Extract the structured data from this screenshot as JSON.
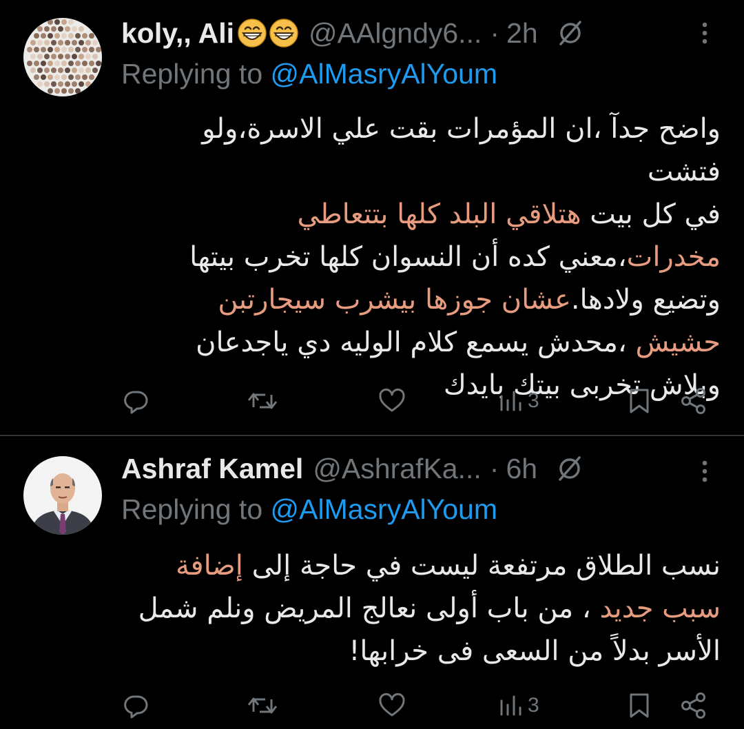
{
  "tweets": [
    {
      "display_name": "koly,, Ali",
      "emoji_icons": [
        "grinning-face-icon",
        "grinning-face-icon"
      ],
      "handle": "@AAlgndy6...",
      "separator": "·",
      "time": "2h",
      "replying_prefix": "Replying to ",
      "replying_to": "@AlMasryAlYoum",
      "body_lines": [
        {
          "a": "واضح جدآ ،ان المؤمرات بقت علي الاسرة،ولو فتشت"
        },
        {
          "a": "في كل بيت ",
          "hl": "هتلاقي البلد كلها بتتعاطي"
        },
        {
          "hl": "مخدرات",
          "b": "،معني كده أن النسوان كلها تخرب بيتها"
        },
        {
          "a": "وتضيع ولادها.",
          "hl": "عشان جوزها بيشرب سيجارتبن"
        },
        {
          "hl": "حشيش",
          "b": " ،محدش يسمع كلام الوليه دي ياجدعان"
        },
        {
          "a": "وبلاش تخربى بيتك بايدك"
        }
      ],
      "views": "3"
    },
    {
      "display_name": "Ashraf Kamel",
      "handle": "@AshrafKa...",
      "separator": "·",
      "time": "6h",
      "replying_prefix": "Replying to ",
      "replying_to": "@AlMasryAlYoum",
      "body_lines": [
        {
          "a": "نسب الطلاق مرتفعة ليست في حاجة إلى ",
          "hl": "إضافة"
        },
        {
          "hl": "سبب جديد",
          "b": " ، من باب أولى نعالج المريض ونلم شمل"
        },
        {
          "a": "الأسر بدلاً من السعى فى خرابها!"
        }
      ],
      "views": "3"
    }
  ],
  "colors": {
    "background": "#000000",
    "text": "#e7e9ea",
    "secondary": "#71767b",
    "mention": "#1d9bf0",
    "highlight": "#e79c7f",
    "divider": "#2f3336"
  },
  "icons": {
    "more": "more-vertical-icon",
    "grok": "grok-slash-icon",
    "reply": "reply-bubble-icon",
    "repost": "repost-icon",
    "like": "heart-icon",
    "views": "views-bar-chart-icon",
    "bookmark": "bookmark-icon",
    "share": "share-icon"
  }
}
